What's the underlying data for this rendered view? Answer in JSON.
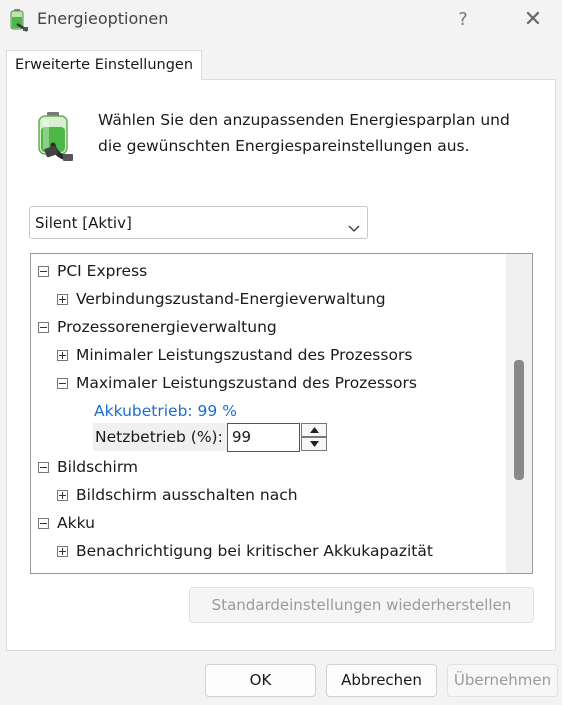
{
  "window": {
    "title": "Energieoptionen",
    "help_label": "?",
    "close_label": "✕"
  },
  "tab": {
    "label": "Erweiterte Einstellungen"
  },
  "description": "Wählen Sie den anzupassenden Energiesparplan und die gewünschten Energiespareinstellungen aus.",
  "plan_dropdown": {
    "value": "Silent [Aktiv]"
  },
  "tree": {
    "items": [
      {
        "label": "PCI Express",
        "state": "expanded"
      },
      {
        "label": "Verbindungszustand-Energieverwaltung",
        "state": "collapsed"
      },
      {
        "label": "Prozessorenergieverwaltung",
        "state": "expanded"
      },
      {
        "label": "Minimaler Leistungszustand des Prozessors",
        "state": "collapsed"
      },
      {
        "label": "Maximaler Leistungszustand des Prozessors",
        "state": "expanded"
      },
      {
        "label": "Akkubetrieb: 99 %"
      },
      {
        "label": "Bildschirm",
        "state": "expanded"
      },
      {
        "label": "Bildschirm ausschalten nach",
        "state": "collapsed"
      },
      {
        "label": "Akku",
        "state": "expanded"
      },
      {
        "label": "Benachrichtigung bei kritischer Akkukapazität",
        "state": "collapsed"
      }
    ],
    "netz_label": "Netzbetrieb (%):",
    "netz_value": "99"
  },
  "buttons": {
    "restore": "Standardeinstellungen wiederherstellen",
    "ok": "OK",
    "cancel": "Abbrechen",
    "apply": "Übernehmen"
  },
  "colors": {
    "accent_link": "#1a6fd6",
    "battery_green": "#4cb848"
  }
}
